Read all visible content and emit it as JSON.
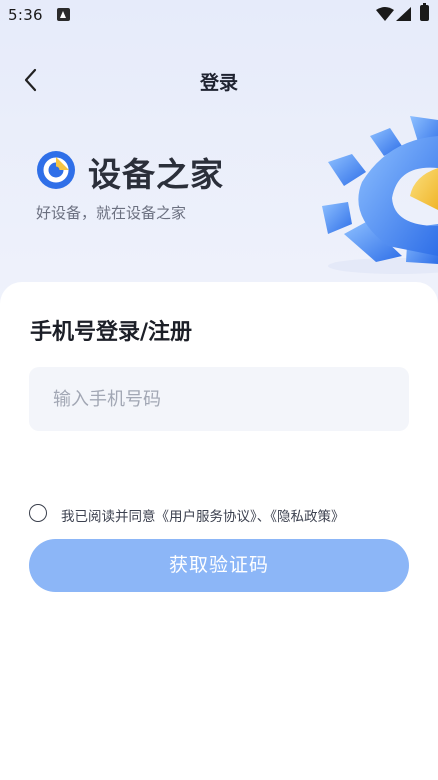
{
  "status_bar": {
    "time": "5:36",
    "icons": [
      "android-icon",
      "wifi-icon",
      "signal-icon",
      "battery-icon"
    ]
  },
  "nav": {
    "title": "登录",
    "back_icon": "chevron-left-icon"
  },
  "brand": {
    "name": "设备之家",
    "slogan": "好设备，就在设备之家",
    "logo_icon": "brand-logo-icon",
    "decoration": "gear-icon"
  },
  "form": {
    "heading": "手机号登录/注册",
    "phone_placeholder": "输入手机号码",
    "phone_value": "",
    "agreement": {
      "prefix": "我已阅读并同意",
      "terms": "《用户服务协议》",
      "separator": "、",
      "privacy": "《隐私政策》",
      "checked": false
    },
    "submit_label": "获取验证码"
  },
  "colors": {
    "primary_disabled": "#8cb6f7",
    "brand_blue": "#2f6fe8",
    "brand_yellow": "#f5c443",
    "input_bg": "#f3f5fa"
  }
}
